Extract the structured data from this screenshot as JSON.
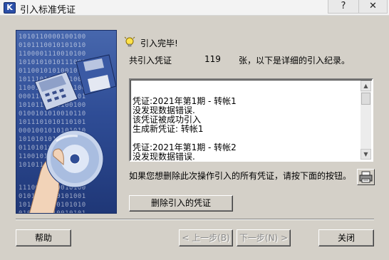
{
  "window": {
    "title": "引入标准凭证",
    "app_icon": "K",
    "help_glyph": "?",
    "close_glyph": "✕"
  },
  "sidebar": {
    "binary_top": "1010110000100100\n0101110010101010\n1100001110010100\n1010101010111000\n0110010101001011\n1011101011011000\n1100101001010100\n0001101010100101\n1010110010100100\n0100101010010110\n1011101010110101\n0001001010101010\n1010101011010100\n0110101010101001\n1100101010010100\n1010111011010101",
    "binary_bottom": "1110001010010100\n0101010110101001\n1011101010101010\n0100101010010101"
  },
  "status": {
    "done_text": "引入完毕!",
    "count_label": "共引入凭证",
    "count_value": "119",
    "count_suffix": "张，以下是详细的引入纪录。"
  },
  "log": {
    "lines": [
      "凭证:2021年第1期 - 转帐1",
      "没发现数据错误.",
      "该凭证被成功引入",
      "生成新凭证: 转帐1",
      "",
      "凭证:2021年第1期 - 转帐2",
      "没发现数据错误."
    ]
  },
  "hint": {
    "text": "如果您想删除此次操作引入的所有凭证，请按下面的按钮。"
  },
  "buttons": {
    "delete": "删除引入的凭证",
    "help": "帮助",
    "prev": "< 上一步(B)",
    "next": "下一步(N) >",
    "close": "关闭"
  },
  "icons": {
    "done": "lightbulb-icon",
    "printer": "printer-icon",
    "scroll_up": "arrow-up-icon",
    "scroll_down": "arrow-down-icon"
  }
}
